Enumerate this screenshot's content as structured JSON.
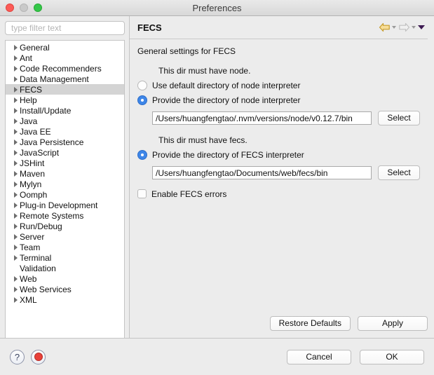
{
  "window": {
    "title": "Preferences",
    "traffic_lights": [
      "close-red",
      "minimize-grey",
      "maximize-green"
    ]
  },
  "sidebar": {
    "filter": {
      "placeholder": "type filter text",
      "value": ""
    },
    "items": [
      {
        "label": "General",
        "expandable": true,
        "selected": false
      },
      {
        "label": "Ant",
        "expandable": true,
        "selected": false
      },
      {
        "label": "Code Recommenders",
        "expandable": true,
        "selected": false
      },
      {
        "label": "Data Management",
        "expandable": true,
        "selected": false
      },
      {
        "label": "FECS",
        "expandable": true,
        "selected": true
      },
      {
        "label": "Help",
        "expandable": true,
        "selected": false
      },
      {
        "label": "Install/Update",
        "expandable": true,
        "selected": false
      },
      {
        "label": "Java",
        "expandable": true,
        "selected": false
      },
      {
        "label": "Java EE",
        "expandable": true,
        "selected": false
      },
      {
        "label": "Java Persistence",
        "expandable": true,
        "selected": false
      },
      {
        "label": "JavaScript",
        "expandable": true,
        "selected": false
      },
      {
        "label": "JSHint",
        "expandable": true,
        "selected": false
      },
      {
        "label": "Maven",
        "expandable": true,
        "selected": false
      },
      {
        "label": "Mylyn",
        "expandable": true,
        "selected": false
      },
      {
        "label": "Oomph",
        "expandable": true,
        "selected": false
      },
      {
        "label": "Plug-in Development",
        "expandable": true,
        "selected": false
      },
      {
        "label": "Remote Systems",
        "expandable": true,
        "selected": false
      },
      {
        "label": "Run/Debug",
        "expandable": true,
        "selected": false
      },
      {
        "label": "Server",
        "expandable": true,
        "selected": false
      },
      {
        "label": "Team",
        "expandable": true,
        "selected": false
      },
      {
        "label": "Terminal",
        "expandable": true,
        "selected": false
      },
      {
        "label": "Validation",
        "expandable": false,
        "selected": false
      },
      {
        "label": "Web",
        "expandable": true,
        "selected": false
      },
      {
        "label": "Web Services",
        "expandable": true,
        "selected": false
      },
      {
        "label": "XML",
        "expandable": true,
        "selected": false
      }
    ]
  },
  "pane": {
    "title": "FECS",
    "nav": {
      "back_icon": "back-arrow-icon",
      "forward_icon": "forward-arrow-icon",
      "menu_icon": "view-menu-triangle-icon",
      "back_color": "#f2d98a",
      "forward_color": "#e3e3e3",
      "menu_color": "#3d1a52"
    },
    "section_title": "General settings for FECS",
    "node_group": {
      "hint": "This dir must have node.",
      "option_default": {
        "label": "Use default directory of node interpreter",
        "selected": false
      },
      "option_provide": {
        "label": "Provide the directory of node interpreter",
        "selected": true
      },
      "path_value": "/Users/huangfengtao/.nvm/versions/node/v0.12.7/bin",
      "select_label": "Select"
    },
    "fecs_group": {
      "hint": "This dir must have fecs.",
      "option_provide": {
        "label": "Provide the directory of FECS interpreter",
        "selected": true
      },
      "path_value": "/Users/huangfengtao/Documents/web/fecs/bin",
      "select_label": "Select"
    },
    "enable_errors": {
      "label": "Enable FECS errors",
      "checked": false
    },
    "restore_defaults_label": "Restore Defaults",
    "apply_label": "Apply"
  },
  "bottom": {
    "help_icon": "question-mark-icon",
    "stop_icon": "stop-record-icon",
    "cancel_label": "Cancel",
    "ok_label": "OK"
  }
}
